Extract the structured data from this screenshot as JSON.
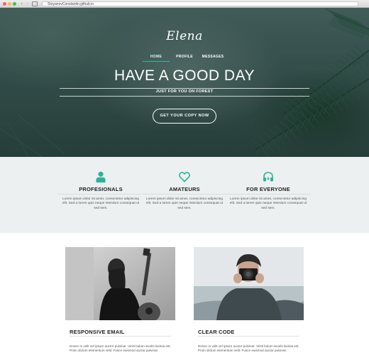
{
  "browser": {
    "url": "StoyanovConstantin.github.io",
    "back_glyph": "‹",
    "forward_glyph": "›"
  },
  "hero": {
    "logo": "Elena",
    "menu": [
      {
        "label": "HOME",
        "active": true
      },
      {
        "label": "PROFILE",
        "active": false
      },
      {
        "label": "MESSAGES",
        "active": false
      }
    ],
    "title": "HAVE A GOOD DAY",
    "subtitle": "JUST FOR YOU ON FOREST",
    "cta_label": "GET YOUR COPY NOW"
  },
  "features": [
    {
      "icon": "user-icon",
      "title": "PROFESIONALS",
      "text": "Lorem ipsum dolor sit amet, consectetur adipiscing elit. Sed a lorem quis neque interdum consequat ut sed sem."
    },
    {
      "icon": "heart-icon",
      "title": "AMATEURS",
      "text": "Lorem ipsum dolor sit amet, consectetur adipiscing elit. Sed a lorem quis neque interdum consequat ut sed sem."
    },
    {
      "icon": "headphones-icon",
      "title": "FOR EVERYONE",
      "text": "Lorem ipsum dolor sit amet, consectetur adipiscing elit. Sed a lorem quis neque interdum consequat ut sed sem."
    }
  ],
  "cards": [
    {
      "image": "woman-with-guitar-photo",
      "title": "RESPONSIVE EMAIL",
      "text": "Donec in velit vel ipsum auctor pulvinar. Vesti bulum iaculis lacinia est. Proin dictum elementum velit. Fusce euismod auctor pulvinar."
    },
    {
      "image": "man-with-camera-photo",
      "title": "CLEAR CODE",
      "text": "Donec in velit vel ipsum auctor pulvinar. Vesti bulum iaculis lacinia est. Proin dictum elementum velit. Fusce euismod auctor pulvinar."
    }
  ],
  "colors": {
    "accent": "#2bb39a",
    "feature_bg": "#ecf0f0"
  }
}
